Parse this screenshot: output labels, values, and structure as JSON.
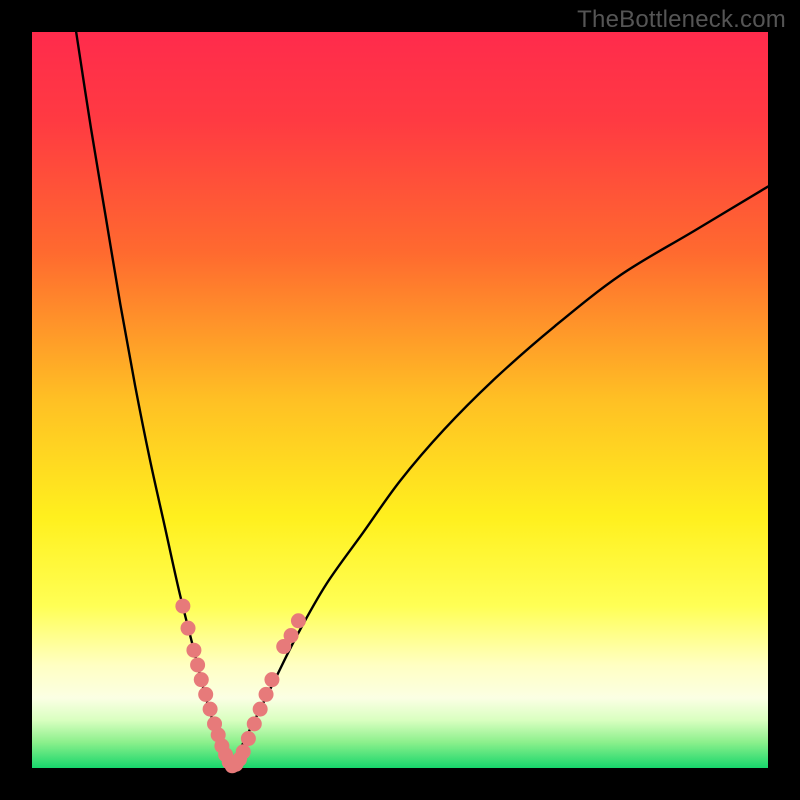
{
  "watermark": "TheBottleneck.com",
  "colors": {
    "frame": "#000000",
    "curve": "#000000",
    "dot_fill": "#e77a7a",
    "dot_stroke": "#d95b5b",
    "gradient_stops": [
      {
        "offset": 0.0,
        "color": "#ff2b4c"
      },
      {
        "offset": 0.12,
        "color": "#ff3a42"
      },
      {
        "offset": 0.3,
        "color": "#ff6a2f"
      },
      {
        "offset": 0.5,
        "color": "#ffc024"
      },
      {
        "offset": 0.66,
        "color": "#fff01e"
      },
      {
        "offset": 0.78,
        "color": "#ffff55"
      },
      {
        "offset": 0.86,
        "color": "#ffffc2"
      },
      {
        "offset": 0.905,
        "color": "#fbffe4"
      },
      {
        "offset": 0.935,
        "color": "#d9ffc0"
      },
      {
        "offset": 0.965,
        "color": "#8cf08c"
      },
      {
        "offset": 1.0,
        "color": "#17d66b"
      }
    ]
  },
  "chart_data": {
    "type": "line",
    "title": "",
    "xlabel": "",
    "ylabel": "",
    "xlim": [
      0,
      100
    ],
    "ylim": [
      0,
      100
    ],
    "notes": "Bottleneck V-curve: y is estimated bottleneck percentage vs normalized x position. Axes have no tick labels in the source image; x and y scaled 0–100. Left branch rises steeply toward the left edge; right branch rises more gradually toward the right edge. Minimum (~0%) occurs near x≈27.",
    "series": [
      {
        "name": "left-branch",
        "x": [
          6,
          8,
          10,
          12,
          14,
          16,
          18,
          20,
          22,
          23.5,
          25,
          26,
          27
        ],
        "values": [
          100,
          87,
          75,
          63,
          52,
          42,
          33,
          24,
          16,
          10,
          5,
          2,
          0
        ]
      },
      {
        "name": "right-branch",
        "x": [
          27,
          28,
          30,
          33,
          36,
          40,
          45,
          50,
          56,
          63,
          71,
          80,
          90,
          100
        ],
        "values": [
          0,
          2,
          6,
          12,
          18,
          25,
          32,
          39,
          46,
          53,
          60,
          67,
          73,
          79
        ]
      }
    ],
    "highlight_points": {
      "note": "Salmon dots overlaid on the curve in the lower region of the V, values in same 0–100 space.",
      "points": [
        {
          "x": 20.5,
          "y": 22
        },
        {
          "x": 21.2,
          "y": 19
        },
        {
          "x": 22.0,
          "y": 16
        },
        {
          "x": 22.5,
          "y": 14
        },
        {
          "x": 23.0,
          "y": 12
        },
        {
          "x": 23.6,
          "y": 10
        },
        {
          "x": 24.2,
          "y": 8
        },
        {
          "x": 24.8,
          "y": 6
        },
        {
          "x": 25.3,
          "y": 4.5
        },
        {
          "x": 25.8,
          "y": 3
        },
        {
          "x": 26.3,
          "y": 1.8
        },
        {
          "x": 26.8,
          "y": 0.8
        },
        {
          "x": 27.2,
          "y": 0.3
        },
        {
          "x": 27.7,
          "y": 0.5
        },
        {
          "x": 28.2,
          "y": 1.2
        },
        {
          "x": 28.7,
          "y": 2.2
        },
        {
          "x": 29.4,
          "y": 4
        },
        {
          "x": 30.2,
          "y": 6
        },
        {
          "x": 31.0,
          "y": 8
        },
        {
          "x": 31.8,
          "y": 10
        },
        {
          "x": 32.6,
          "y": 12
        },
        {
          "x": 34.2,
          "y": 16.5
        },
        {
          "x": 35.2,
          "y": 18
        },
        {
          "x": 36.2,
          "y": 20
        }
      ]
    }
  }
}
